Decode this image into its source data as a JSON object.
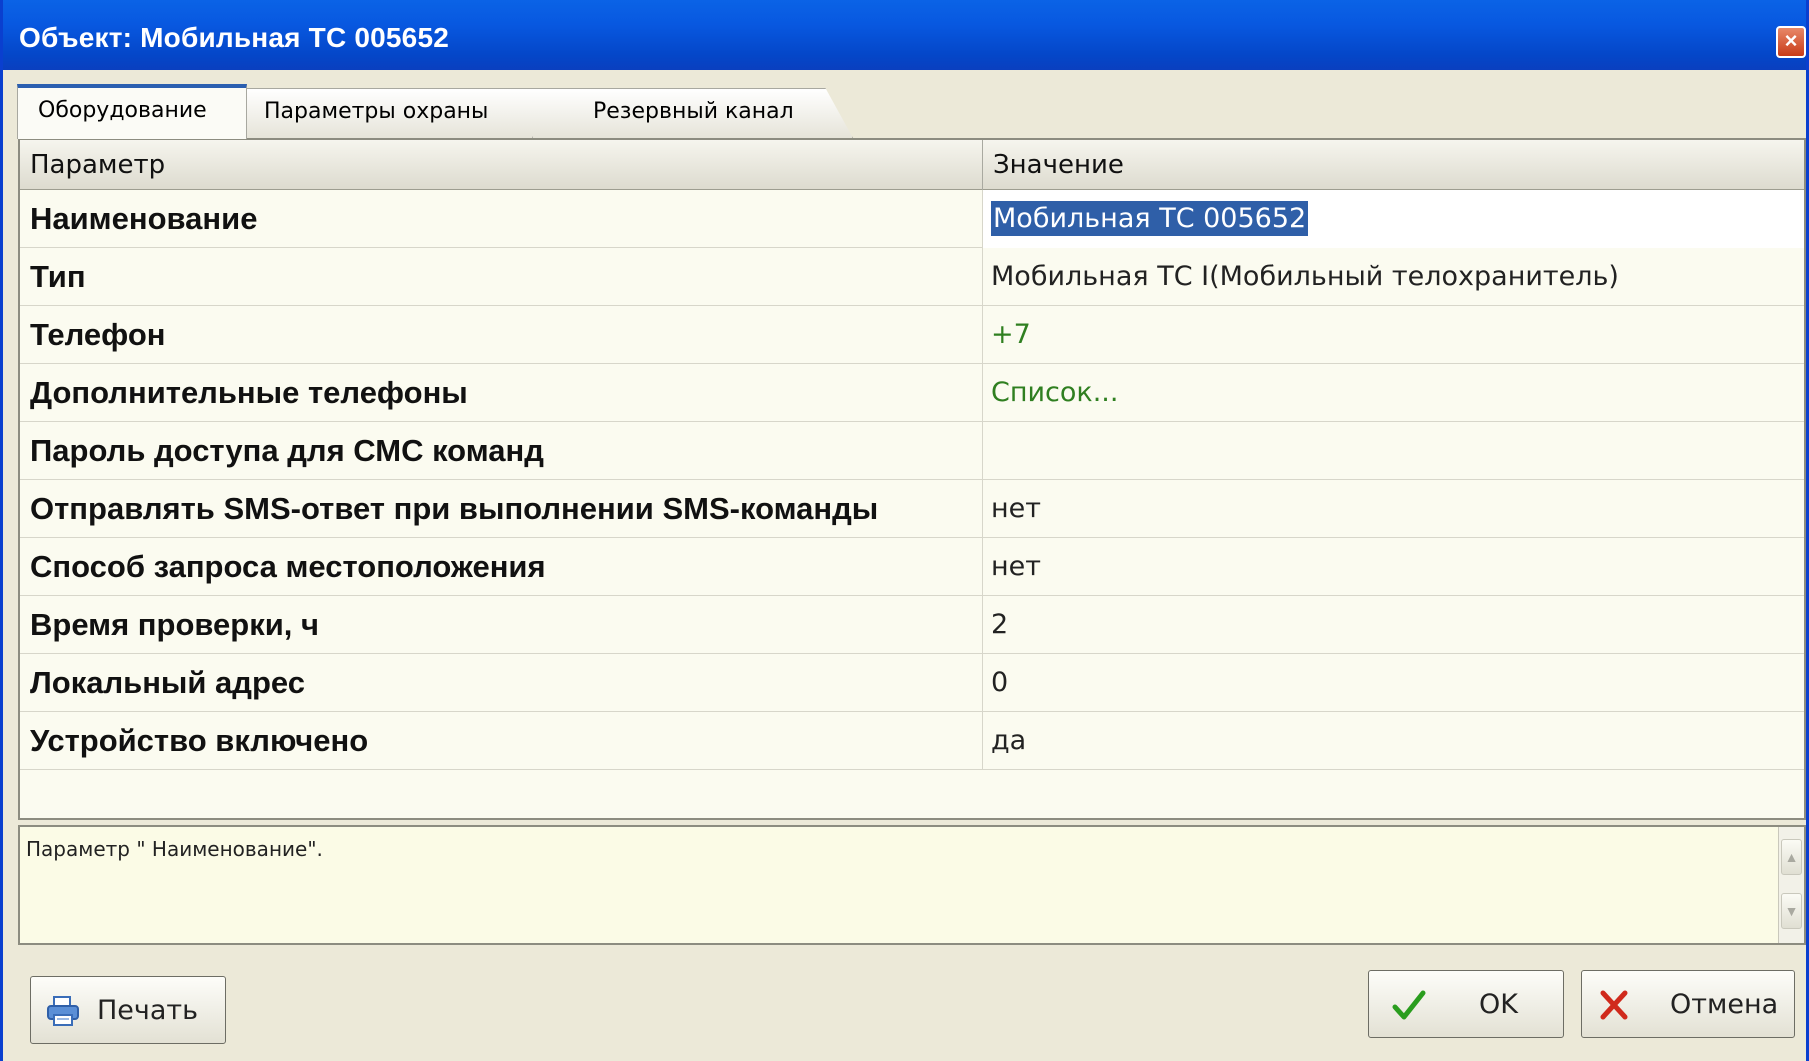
{
  "window": {
    "title": "Объект: Мобильная ТС 005652",
    "close_label": "×"
  },
  "tabs": [
    {
      "label": "Оборудование",
      "active": true
    },
    {
      "label": "Параметры охраны",
      "active": false
    },
    {
      "label": "Резервный канал",
      "active": false
    }
  ],
  "grid": {
    "headers": {
      "param": "Параметр",
      "value": "Значение"
    },
    "rows": [
      {
        "param": "Наименование",
        "value": "Мобильная ТС 005652",
        "selected": true
      },
      {
        "param": "Тип",
        "value": "Мобильная ТС I(Мобильный телохранитель)"
      },
      {
        "param": "Телефон",
        "value": "+7",
        "link": true
      },
      {
        "param": "Дополнительные телефоны",
        "value": "Список...",
        "link": true
      },
      {
        "param": "Пароль доступа для СМС команд",
        "value": ""
      },
      {
        "param": "Отправлять SMS-ответ при выполнении SMS-команды",
        "value": "нет"
      },
      {
        "param": "Способ запроса местоположения",
        "value": "нет"
      },
      {
        "param": "Время проверки, ч",
        "value": "2"
      },
      {
        "param": "Локальный адрес",
        "value": "0"
      },
      {
        "param": "Устройство включено",
        "value": "да"
      }
    ]
  },
  "description": {
    "text": "Параметр \" Наименование\"."
  },
  "buttons": {
    "print": "Печать",
    "ok": "OK",
    "cancel": "Отмена"
  },
  "colors": {
    "titlebar": "#0b5be0",
    "link_value": "#2f7f20",
    "selection": "#2f5fa8"
  },
  "icons": {
    "print": "printer-icon",
    "ok": "checkmark-icon",
    "cancel": "cross-icon"
  }
}
